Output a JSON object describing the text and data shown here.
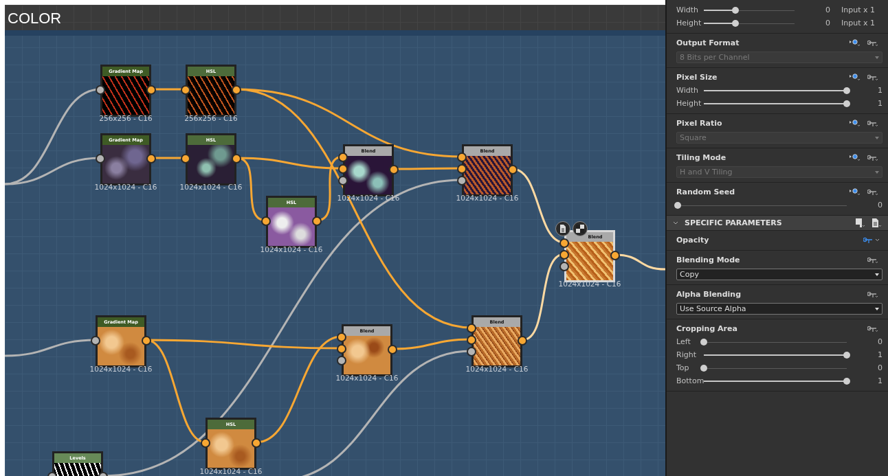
{
  "graph": {
    "title": "COLOR",
    "nodes": [
      {
        "kind": "gradient_map",
        "title": "Gradient Map",
        "size": "256x256 - C16",
        "selected": false
      },
      {
        "kind": "hsl",
        "title": "HSL",
        "size": "256x256 - C16",
        "selected": false
      },
      {
        "kind": "gradient_map",
        "title": "Gradient Map",
        "size": "1024x1024 - C16",
        "selected": false
      },
      {
        "kind": "hsl",
        "title": "HSL",
        "size": "1024x1024 - C16",
        "selected": false
      },
      {
        "kind": "hsl",
        "title": "HSL",
        "size": "1024x1024 - C16",
        "selected": false
      },
      {
        "kind": "blend",
        "title": "Blend",
        "size": "1024x1024 - C16",
        "selected": false
      },
      {
        "kind": "blend",
        "title": "Blend",
        "size": "1024x1024 - C16",
        "selected": false
      },
      {
        "kind": "blend",
        "title": "Blend",
        "size": "1024x1024 - C16",
        "selected": true
      },
      {
        "kind": "gradient_map",
        "title": "Gradient Map",
        "size": "1024x1024 - C16",
        "selected": false
      },
      {
        "kind": "blend",
        "title": "Blend",
        "size": "1024x1024 - C16",
        "selected": false
      },
      {
        "kind": "blend",
        "title": "Blend",
        "size": "1024x1024 - C16",
        "selected": false
      },
      {
        "kind": "hsl",
        "title": "HSL",
        "size": "1024x1024 - C16",
        "selected": false
      },
      {
        "kind": "levels",
        "title": "Levels",
        "selected": false
      }
    ]
  },
  "properties": {
    "base_sections": [
      {
        "kind": "sliders",
        "rows": [
          {
            "label": "Width",
            "level": 0.35,
            "value": "0",
            "suffix": "Input x 1"
          },
          {
            "label": "Height",
            "level": 0.35,
            "value": "0",
            "suffix": "Input x 1"
          }
        ]
      },
      {
        "kind": "dropdown",
        "title": "Output Format",
        "value": "8 Bits per Channel",
        "disabled": true
      },
      {
        "kind": "sliders",
        "title": "Pixel Size",
        "rows": [
          {
            "label": "Width",
            "level": 1,
            "value": "1"
          },
          {
            "label": "Height",
            "level": 1,
            "value": "1"
          }
        ]
      },
      {
        "kind": "dropdown",
        "title": "Pixel Ratio",
        "value": "Square",
        "disabled": true
      },
      {
        "kind": "dropdown",
        "title": "Tiling Mode",
        "value": "H and V Tiling",
        "disabled": true
      },
      {
        "kind": "sliders",
        "title": "Random Seed",
        "rows": [
          {
            "level": 0,
            "value": "0"
          }
        ]
      }
    ],
    "group": {
      "title": "SPECIFIC PARAMETERS",
      "expanded": true
    },
    "specific_sections": [
      {
        "kind": "header",
        "title": "Opacity",
        "function_active": true
      },
      {
        "kind": "dropdown",
        "title": "Blending Mode",
        "value": "Copy",
        "disabled": false,
        "function_active": false
      },
      {
        "kind": "dropdown",
        "title": "Alpha Blending",
        "value": "Use Source Alpha",
        "disabled": false,
        "function_active": false
      },
      {
        "kind": "sliders",
        "title": "Cropping Area",
        "function_active": false,
        "rows": [
          {
            "label": "Left",
            "level": 0,
            "value": "0"
          },
          {
            "label": "Right",
            "level": 1,
            "value": "1"
          },
          {
            "label": "Top",
            "level": 0,
            "value": "0"
          },
          {
            "label": "Bottom",
            "level": 1,
            "value": "1"
          }
        ]
      }
    ]
  }
}
